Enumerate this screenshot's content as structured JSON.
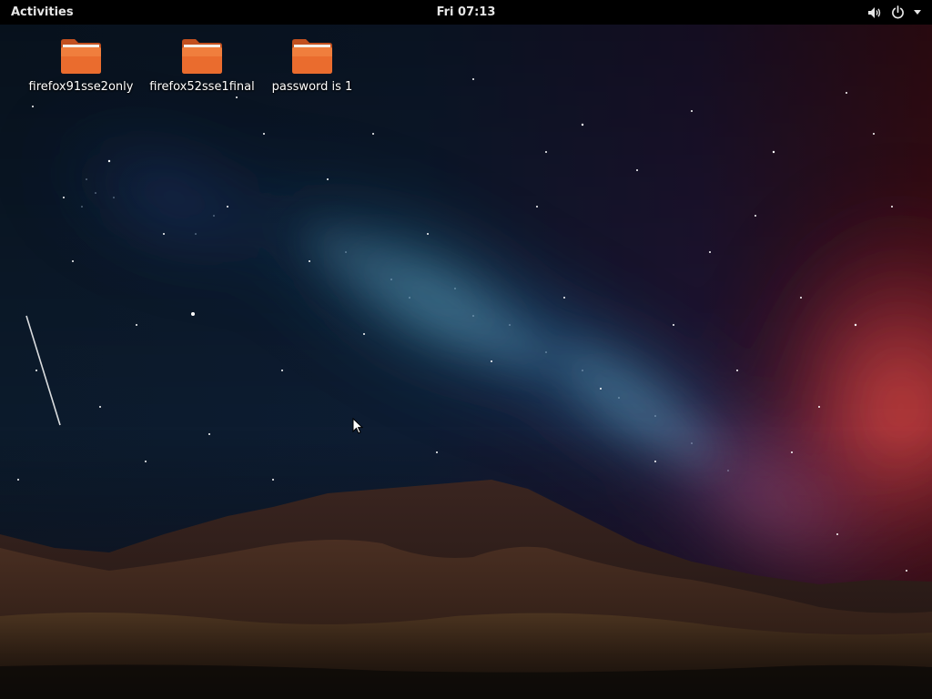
{
  "topbar": {
    "activities_label": "Activities",
    "clock": "Fri 07:13",
    "tray_icons": [
      "volume-icon",
      "power-icon",
      "dropdown-arrow-icon"
    ]
  },
  "desktop": {
    "icons": [
      {
        "label": "firefox91sse2only",
        "icon": "folder-icon"
      },
      {
        "label": "firefox52sse1final",
        "icon": "folder-icon"
      },
      {
        "label": "password is 1",
        "icon": "folder-icon"
      }
    ],
    "wallpaper": "starry-night-sky-over-mountains"
  },
  "colors": {
    "topbar_bg": "#000000",
    "folder_orange": "#e9692c",
    "folder_light": "#f4934f"
  }
}
